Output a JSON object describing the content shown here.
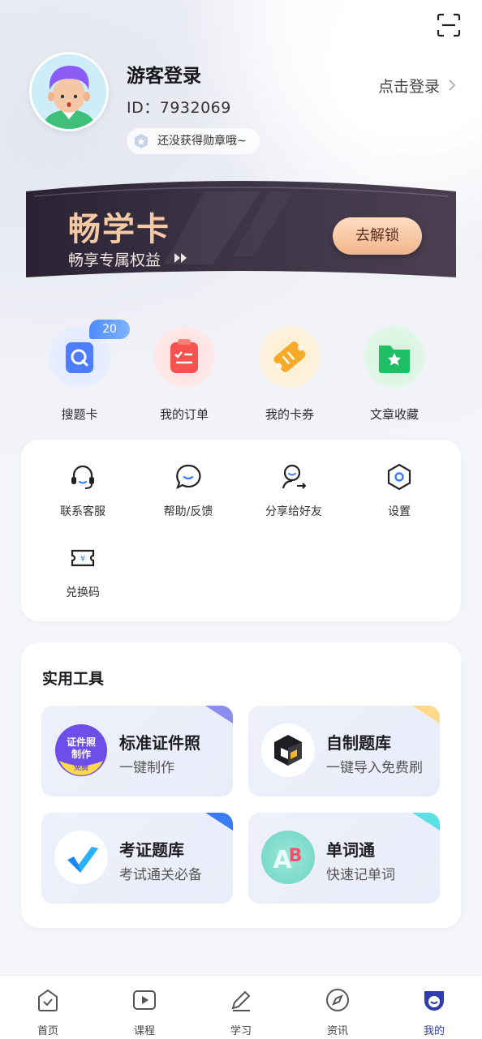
{
  "header": {
    "username": "游客登录",
    "user_id": "ID：7932069",
    "login_link": "点击登录",
    "badge_text": "还没获得勋章哦~"
  },
  "vip_card": {
    "title": "畅学卡",
    "subtitle": "畅享专属权益",
    "button": "去解锁"
  },
  "quick_actions": [
    {
      "label": "搜题卡",
      "badge": "20",
      "icon": "search-card-icon"
    },
    {
      "label": "我的订单",
      "icon": "order-icon"
    },
    {
      "label": "我的卡券",
      "icon": "coupon-icon"
    },
    {
      "label": "文章收藏",
      "icon": "favorite-folder-icon"
    }
  ],
  "services": [
    {
      "label": "联系客服",
      "icon": "headset-icon"
    },
    {
      "label": "帮助/反馈",
      "icon": "chat-bubble-icon"
    },
    {
      "label": "分享给好友",
      "icon": "share-user-icon"
    },
    {
      "label": "设置",
      "icon": "settings-hex-icon"
    },
    {
      "label": "兑换码",
      "icon": "redeem-ticket-icon"
    }
  ],
  "tools": {
    "title": "实用工具",
    "items": [
      {
        "name": "标准证件照",
        "desc": "一键制作",
        "icon_text": [
          "证件照",
          "制作",
          "免费"
        ]
      },
      {
        "name": "自制题库",
        "desc": "一键导入免费刷"
      },
      {
        "name": "考证题库",
        "desc": "考试通关必备"
      },
      {
        "name": "单词通",
        "desc": "快速记单词",
        "icon_text": [
          "A",
          "B"
        ]
      }
    ]
  },
  "tabbar": [
    {
      "label": "首页",
      "icon": "home-icon"
    },
    {
      "label": "课程",
      "icon": "play-icon"
    },
    {
      "label": "学习",
      "icon": "pencil-icon"
    },
    {
      "label": "资讯",
      "icon": "compass-icon"
    },
    {
      "label": "我的",
      "icon": "profile-icon",
      "active": true
    }
  ],
  "colors": {
    "accent": "#2f3ea8",
    "vip_gold": "#f6c9a5",
    "badge_blue": "#4f8cff"
  }
}
